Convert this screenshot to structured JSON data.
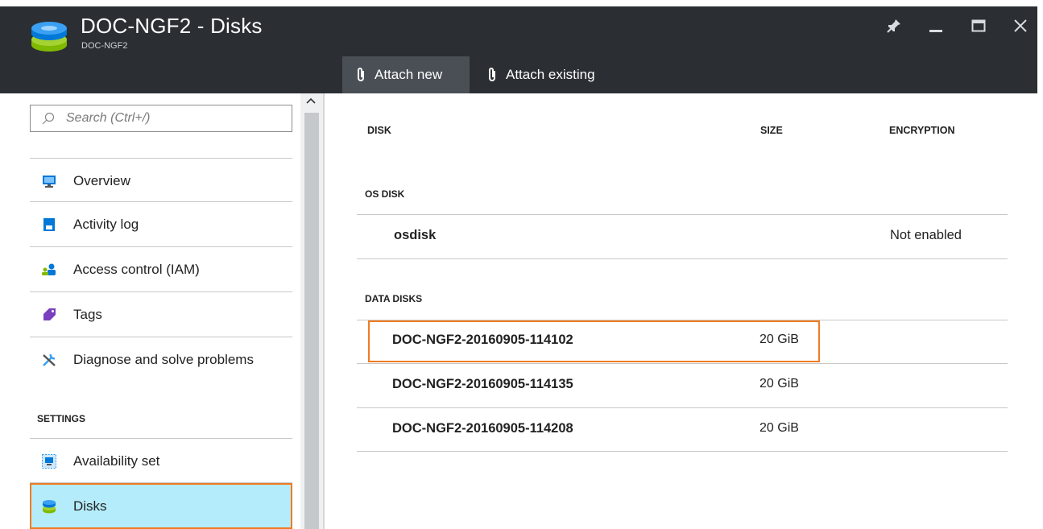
{
  "window": {
    "title": "DOC-NGF2 - Disks",
    "subtitle": "DOC-NGF2",
    "icons": {
      "app": "disks-icon",
      "pin": "pin-icon",
      "minimize": "minimize-icon",
      "maximize": "maximize-icon",
      "close": "close-icon"
    }
  },
  "commands": [
    {
      "label": "Attach new",
      "icon": "paperclip-icon",
      "active": true
    },
    {
      "label": "Attach existing",
      "icon": "paperclip-icon",
      "active": false
    }
  ],
  "sidebar": {
    "search_placeholder": "Search (Ctrl+/)",
    "items": [
      {
        "label": "Overview",
        "icon": "monitor-icon"
      },
      {
        "label": "Activity log",
        "icon": "log-icon"
      },
      {
        "label": "Access control (IAM)",
        "icon": "users-icon"
      },
      {
        "label": "Tags",
        "icon": "tag-icon"
      },
      {
        "label": "Diagnose and solve problems",
        "icon": "tools-icon"
      }
    ],
    "section_label": "SETTINGS",
    "settings_items": [
      {
        "label": "Availability set",
        "icon": "availability-icon"
      },
      {
        "label": "Disks",
        "icon": "disks-icon",
        "selected": true
      }
    ]
  },
  "table": {
    "columns": [
      "DISK",
      "SIZE",
      "ENCRYPTION"
    ],
    "os_group_label": "OS DISK",
    "os_disks": [
      {
        "name": "osdisk",
        "size": "",
        "encryption": "Not enabled"
      }
    ],
    "data_group_label": "DATA DISKS",
    "data_disks": [
      {
        "name": "DOC-NGF2-20160905-114102",
        "size": "20 GiB",
        "encryption": ""
      },
      {
        "name": "DOC-NGF2-20160905-114135",
        "size": "20 GiB",
        "encryption": ""
      },
      {
        "name": "DOC-NGF2-20160905-114208",
        "size": "20 GiB",
        "encryption": ""
      }
    ]
  },
  "colors": {
    "header_bg": "#2b2f33",
    "accent_orange": "#f07b21",
    "selected_bg": "#b4ecfb"
  }
}
